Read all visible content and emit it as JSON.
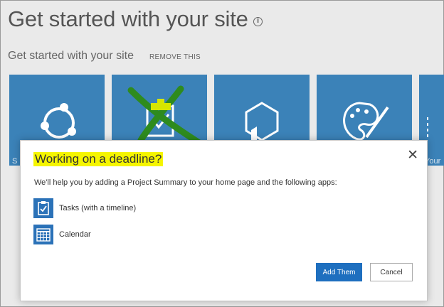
{
  "page": {
    "title": "Get started with your site",
    "info_icon": "info-icon"
  },
  "section": {
    "title": "Get started with your site",
    "remove_label": "REMOVE THIS"
  },
  "tiles": [
    {
      "icon": "share-network-icon",
      "label": "S"
    },
    {
      "icon": "clipboard-check-icon",
      "label": ""
    },
    {
      "icon": "hexagon-cube-icon",
      "label": ""
    },
    {
      "icon": "palette-icon",
      "label": ""
    },
    {
      "icon": "dashed-box-icon",
      "label": "Your"
    }
  ],
  "dialog": {
    "title": "Working on a deadline?",
    "close_icon": "close-icon",
    "description": "We'll help you by adding a Project Summary to your home page and the following apps:",
    "apps": [
      {
        "icon": "tasks-icon",
        "label": "Tasks (with a timeline)"
      },
      {
        "icon": "calendar-icon",
        "label": "Calendar"
      }
    ],
    "primary_button": "Add Them",
    "secondary_button": "Cancel"
  },
  "colors": {
    "tile": "#3b82b8",
    "highlight": "#f5f500",
    "primary": "#1e6fbf",
    "annotation_x": "#2e8b1e"
  }
}
